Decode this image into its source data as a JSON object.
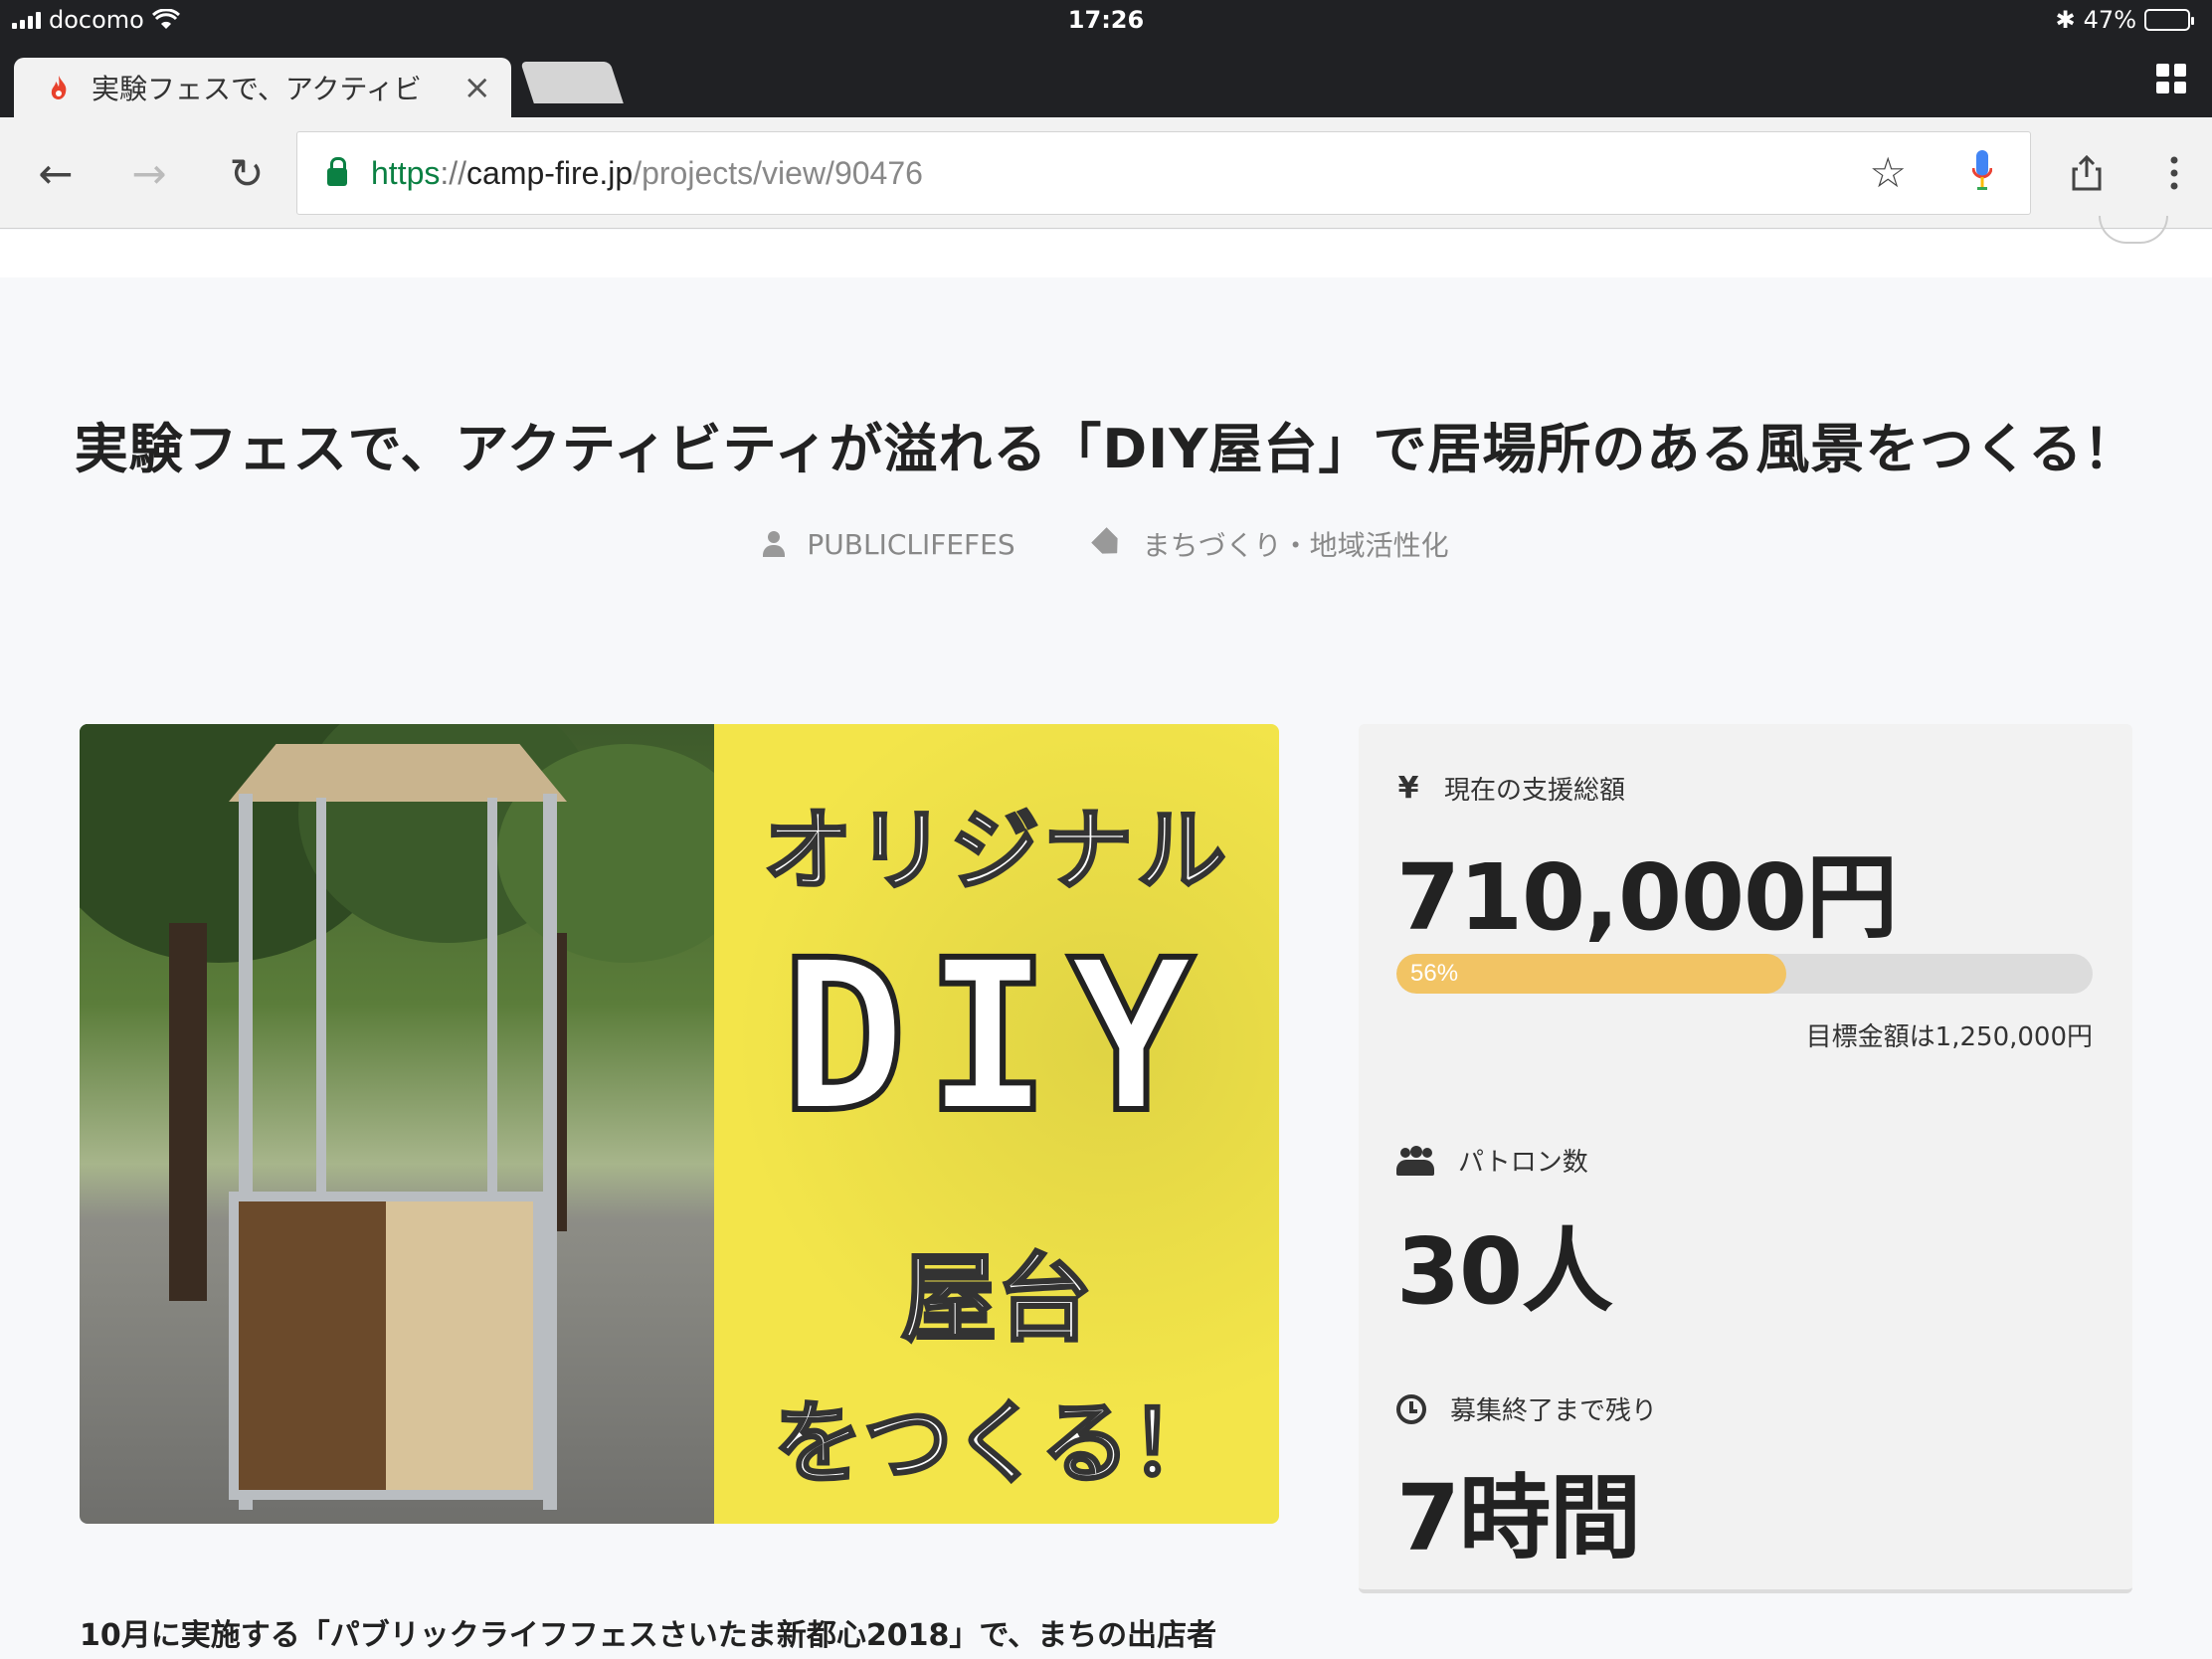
{
  "status_bar": {
    "carrier": "docomo",
    "time": "17:26",
    "battery": "47%"
  },
  "browser": {
    "tab_title": "実験フェスで、アクティビ",
    "url_scheme": "https",
    "url_sep": "://",
    "url_host": "camp-fire.jp",
    "url_path": "/projects/view/90476"
  },
  "project": {
    "title": "実験フェスで、アクティビティが溢れる「DIY屋台」で居場所のある風景をつくる！",
    "owner": "PUBLICLIFEFES",
    "category": "まちづくり・地域活性化",
    "hero": {
      "line1": "オリジナル",
      "line2": "DIY",
      "line3": "屋台",
      "line4": "をつくる！"
    },
    "description": "10月に実施する「パブリックライフフェスさいたま新都心2018」で、まちの出店者"
  },
  "stats": {
    "funding_label": "現在の支援総額",
    "funding_value": "710,000円",
    "progress_percent": 56,
    "progress_text": "56%",
    "goal_text": "目標金額は1,250,000円",
    "patrons_label": "パトロン数",
    "patrons_value": "30人",
    "remaining_label": "募集終了まで残り",
    "remaining_value": "7時間"
  },
  "colors": {
    "progress_fill": "#f2c464",
    "secure_green": "#0b8043",
    "hero_yellow": "#f3e54a"
  }
}
